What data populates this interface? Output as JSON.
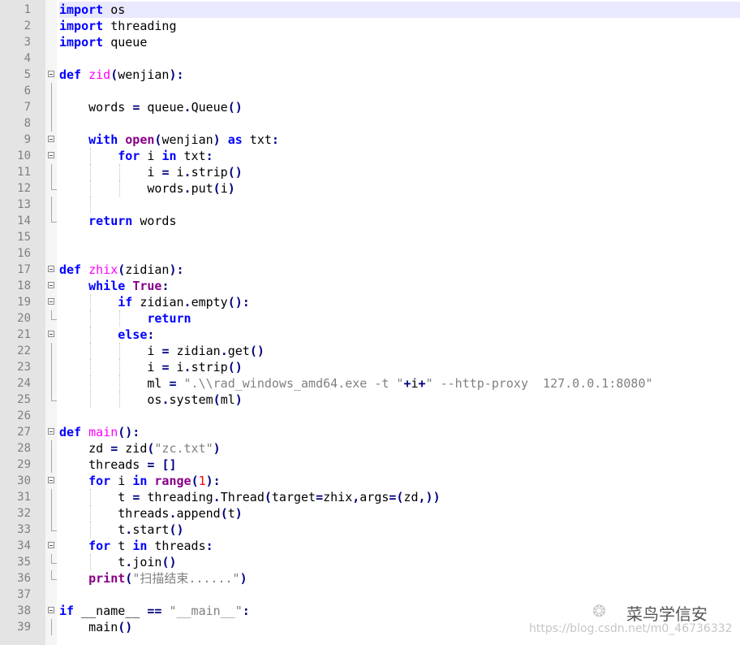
{
  "editor": {
    "lines": [
      {
        "n": "1",
        "fold": "none",
        "guides": [],
        "current": true,
        "tokens": [
          {
            "t": "import",
            "c": "kw"
          },
          {
            "t": " os"
          }
        ]
      },
      {
        "n": "2",
        "fold": "none",
        "guides": [],
        "tokens": [
          {
            "t": "import",
            "c": "kw"
          },
          {
            "t": " threading"
          }
        ]
      },
      {
        "n": "3",
        "fold": "none",
        "guides": [],
        "tokens": [
          {
            "t": "import",
            "c": "kw"
          },
          {
            "t": " queue"
          }
        ]
      },
      {
        "n": "4",
        "fold": "none",
        "guides": [],
        "tokens": []
      },
      {
        "n": "5",
        "fold": "open",
        "guides": [],
        "tokens": [
          {
            "t": "def",
            "c": "kw"
          },
          {
            "t": " "
          },
          {
            "t": "zid",
            "c": "fn"
          },
          {
            "t": "(",
            "c": "op"
          },
          {
            "t": "wenjian"
          },
          {
            "t": "):",
            "c": "op"
          }
        ]
      },
      {
        "n": "6",
        "fold": "line",
        "guides": [],
        "tokens": []
      },
      {
        "n": "7",
        "fold": "line",
        "guides": [],
        "tokens": [
          {
            "t": "    words "
          },
          {
            "t": "=",
            "c": "op"
          },
          {
            "t": " queue"
          },
          {
            "t": ".",
            "c": "op"
          },
          {
            "t": "Queue"
          },
          {
            "t": "()",
            "c": "op"
          }
        ]
      },
      {
        "n": "8",
        "fold": "line",
        "guides": [],
        "tokens": []
      },
      {
        "n": "9",
        "fold": "open",
        "guides": [],
        "tokens": [
          {
            "t": "    "
          },
          {
            "t": "with",
            "c": "kw"
          },
          {
            "t": " "
          },
          {
            "t": "open",
            "c": "bi"
          },
          {
            "t": "(",
            "c": "op"
          },
          {
            "t": "wenjian"
          },
          {
            "t": ")",
            "c": "op"
          },
          {
            "t": " "
          },
          {
            "t": "as",
            "c": "kw"
          },
          {
            "t": " txt"
          },
          {
            "t": ":",
            "c": "op"
          }
        ]
      },
      {
        "n": "10",
        "fold": "open",
        "guides": [
          1
        ],
        "tokens": [
          {
            "t": "        "
          },
          {
            "t": "for",
            "c": "kw"
          },
          {
            "t": " i "
          },
          {
            "t": "in",
            "c": "kw"
          },
          {
            "t": " txt"
          },
          {
            "t": ":",
            "c": "op"
          }
        ]
      },
      {
        "n": "11",
        "fold": "line",
        "guides": [
          1,
          2
        ],
        "tokens": [
          {
            "t": "            i "
          },
          {
            "t": "=",
            "c": "op"
          },
          {
            "t": " i"
          },
          {
            "t": ".",
            "c": "op"
          },
          {
            "t": "strip"
          },
          {
            "t": "()",
            "c": "op"
          }
        ]
      },
      {
        "n": "12",
        "fold": "end",
        "guides": [
          1,
          2
        ],
        "tokens": [
          {
            "t": "            words"
          },
          {
            "t": ".",
            "c": "op"
          },
          {
            "t": "put"
          },
          {
            "t": "(",
            "c": "op"
          },
          {
            "t": "i"
          },
          {
            "t": ")",
            "c": "op"
          }
        ]
      },
      {
        "n": "13",
        "fold": "line",
        "guides": [
          1
        ],
        "tokens": []
      },
      {
        "n": "14",
        "fold": "end",
        "guides": [],
        "tokens": [
          {
            "t": "    "
          },
          {
            "t": "return",
            "c": "kw"
          },
          {
            "t": " words"
          }
        ]
      },
      {
        "n": "15",
        "fold": "none",
        "guides": [],
        "tokens": []
      },
      {
        "n": "16",
        "fold": "none",
        "guides": [],
        "tokens": []
      },
      {
        "n": "17",
        "fold": "open",
        "guides": [],
        "tokens": [
          {
            "t": "def",
            "c": "kw"
          },
          {
            "t": " "
          },
          {
            "t": "zhix",
            "c": "fn"
          },
          {
            "t": "(",
            "c": "op"
          },
          {
            "t": "zidian"
          },
          {
            "t": "):",
            "c": "op"
          }
        ]
      },
      {
        "n": "18",
        "fold": "open",
        "guides": [],
        "tokens": [
          {
            "t": "    "
          },
          {
            "t": "while",
            "c": "kw"
          },
          {
            "t": " "
          },
          {
            "t": "True",
            "c": "bi"
          },
          {
            "t": ":",
            "c": "op"
          }
        ]
      },
      {
        "n": "19",
        "fold": "open",
        "guides": [
          1
        ],
        "tokens": [
          {
            "t": "        "
          },
          {
            "t": "if",
            "c": "kw"
          },
          {
            "t": " zidian"
          },
          {
            "t": ".",
            "c": "op"
          },
          {
            "t": "empty"
          },
          {
            "t": "():",
            "c": "op"
          }
        ]
      },
      {
        "n": "20",
        "fold": "end",
        "guides": [
          1,
          2
        ],
        "tokens": [
          {
            "t": "            "
          },
          {
            "t": "return",
            "c": "kw"
          }
        ]
      },
      {
        "n": "21",
        "fold": "open",
        "guides": [
          1
        ],
        "tokens": [
          {
            "t": "        "
          },
          {
            "t": "else",
            "c": "kw"
          },
          {
            "t": ":",
            "c": "op"
          }
        ]
      },
      {
        "n": "22",
        "fold": "line",
        "guides": [
          1,
          2
        ],
        "tokens": [
          {
            "t": "            i "
          },
          {
            "t": "=",
            "c": "op"
          },
          {
            "t": " zidian"
          },
          {
            "t": ".",
            "c": "op"
          },
          {
            "t": "get"
          },
          {
            "t": "()",
            "c": "op"
          }
        ]
      },
      {
        "n": "23",
        "fold": "line",
        "guides": [
          1,
          2
        ],
        "tokens": [
          {
            "t": "            i "
          },
          {
            "t": "=",
            "c": "op"
          },
          {
            "t": " i"
          },
          {
            "t": ".",
            "c": "op"
          },
          {
            "t": "strip"
          },
          {
            "t": "()",
            "c": "op"
          }
        ]
      },
      {
        "n": "24",
        "fold": "line",
        "guides": [
          1,
          2
        ],
        "tokens": [
          {
            "t": "            ml "
          },
          {
            "t": "=",
            "c": "op"
          },
          {
            "t": " "
          },
          {
            "t": "\".\\\\rad_windows_amd64.exe -t \"",
            "c": "str"
          },
          {
            "t": "+",
            "c": "op"
          },
          {
            "t": "i"
          },
          {
            "t": "+",
            "c": "op"
          },
          {
            "t": "\" --http-proxy  127.0.0.1:8080\"",
            "c": "str"
          }
        ]
      },
      {
        "n": "25",
        "fold": "end",
        "guides": [
          1,
          2
        ],
        "tokens": [
          {
            "t": "            os"
          },
          {
            "t": ".",
            "c": "op"
          },
          {
            "t": "system"
          },
          {
            "t": "(",
            "c": "op"
          },
          {
            "t": "ml"
          },
          {
            "t": ")",
            "c": "op"
          }
        ]
      },
      {
        "n": "26",
        "fold": "none",
        "guides": [],
        "tokens": []
      },
      {
        "n": "27",
        "fold": "open",
        "guides": [],
        "tokens": [
          {
            "t": "def",
            "c": "kw"
          },
          {
            "t": " "
          },
          {
            "t": "main",
            "c": "fn"
          },
          {
            "t": "():",
            "c": "op"
          }
        ]
      },
      {
        "n": "28",
        "fold": "line",
        "guides": [],
        "tokens": [
          {
            "t": "    zd "
          },
          {
            "t": "=",
            "c": "op"
          },
          {
            "t": " zid"
          },
          {
            "t": "(",
            "c": "op"
          },
          {
            "t": "\"zc.txt\"",
            "c": "str"
          },
          {
            "t": ")",
            "c": "op"
          }
        ]
      },
      {
        "n": "29",
        "fold": "line",
        "guides": [],
        "tokens": [
          {
            "t": "    threads "
          },
          {
            "t": "=",
            "c": "op"
          },
          {
            "t": " "
          },
          {
            "t": "[]",
            "c": "op"
          }
        ]
      },
      {
        "n": "30",
        "fold": "open",
        "guides": [],
        "tokens": [
          {
            "t": "    "
          },
          {
            "t": "for",
            "c": "kw"
          },
          {
            "t": " i "
          },
          {
            "t": "in",
            "c": "kw"
          },
          {
            "t": " "
          },
          {
            "t": "range",
            "c": "bi"
          },
          {
            "t": "(",
            "c": "op"
          },
          {
            "t": "1",
            "c": "num"
          },
          {
            "t": "):",
            "c": "op"
          }
        ]
      },
      {
        "n": "31",
        "fold": "line",
        "guides": [
          1
        ],
        "tokens": [
          {
            "t": "        t "
          },
          {
            "t": "=",
            "c": "op"
          },
          {
            "t": " threading"
          },
          {
            "t": ".",
            "c": "op"
          },
          {
            "t": "Thread"
          },
          {
            "t": "(",
            "c": "op"
          },
          {
            "t": "target"
          },
          {
            "t": "=",
            "c": "op"
          },
          {
            "t": "zhix"
          },
          {
            "t": ",",
            "c": "op"
          },
          {
            "t": "args"
          },
          {
            "t": "=(",
            "c": "op"
          },
          {
            "t": "zd"
          },
          {
            "t": ",))",
            "c": "op"
          }
        ]
      },
      {
        "n": "32",
        "fold": "line",
        "guides": [
          1
        ],
        "tokens": [
          {
            "t": "        threads"
          },
          {
            "t": ".",
            "c": "op"
          },
          {
            "t": "append"
          },
          {
            "t": "(",
            "c": "op"
          },
          {
            "t": "t"
          },
          {
            "t": ")",
            "c": "op"
          }
        ]
      },
      {
        "n": "33",
        "fold": "end",
        "guides": [
          1
        ],
        "tokens": [
          {
            "t": "        t"
          },
          {
            "t": ".",
            "c": "op"
          },
          {
            "t": "start"
          },
          {
            "t": "()",
            "c": "op"
          }
        ]
      },
      {
        "n": "34",
        "fold": "open",
        "guides": [],
        "tokens": [
          {
            "t": "    "
          },
          {
            "t": "for",
            "c": "kw"
          },
          {
            "t": " t "
          },
          {
            "t": "in",
            "c": "kw"
          },
          {
            "t": " threads"
          },
          {
            "t": ":",
            "c": "op"
          }
        ]
      },
      {
        "n": "35",
        "fold": "end",
        "guides": [
          1
        ],
        "tokens": [
          {
            "t": "        t"
          },
          {
            "t": ".",
            "c": "op"
          },
          {
            "t": "join"
          },
          {
            "t": "()",
            "c": "op"
          }
        ]
      },
      {
        "n": "36",
        "fold": "end",
        "guides": [],
        "tokens": [
          {
            "t": "    "
          },
          {
            "t": "print",
            "c": "bi"
          },
          {
            "t": "(",
            "c": "op"
          },
          {
            "t": "\"扫描结束......\"",
            "c": "str"
          },
          {
            "t": ")",
            "c": "op"
          }
        ]
      },
      {
        "n": "37",
        "fold": "none",
        "guides": [],
        "tokens": []
      },
      {
        "n": "38",
        "fold": "open",
        "guides": [],
        "tokens": [
          {
            "t": "if",
            "c": "kw"
          },
          {
            "t": " __name__ "
          },
          {
            "t": "==",
            "c": "op"
          },
          {
            "t": " "
          },
          {
            "t": "\"__main__\"",
            "c": "str"
          },
          {
            "t": ":",
            "c": "op"
          }
        ]
      },
      {
        "n": "39",
        "fold": "line",
        "guides": [],
        "tokens": [
          {
            "t": "    main"
          },
          {
            "t": "()",
            "c": "op"
          }
        ]
      }
    ]
  },
  "watermark": {
    "icon": "wechat-icon",
    "name": "菜鸟学信安",
    "url": "https://blog.csdn.net/m0_46736332"
  }
}
